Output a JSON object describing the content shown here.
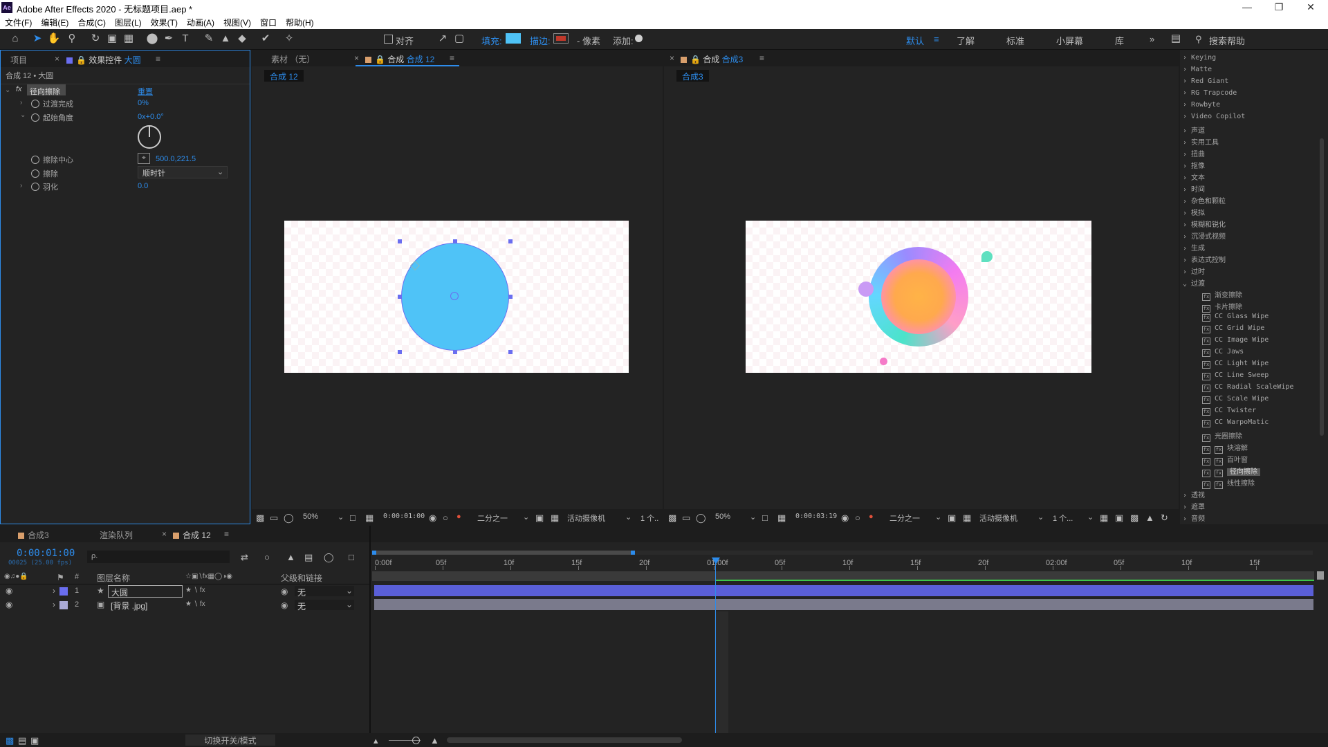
{
  "window": {
    "title": "Adobe After Effects 2020 - 无标题项目.aep *",
    "logo": "Ae"
  },
  "menu": [
    "文件(F)",
    "编辑(E)",
    "合成(C)",
    "图层(L)",
    "效果(T)",
    "动画(A)",
    "视图(V)",
    "窗口",
    "帮助(H)"
  ],
  "toolbar": {
    "align": "对齐",
    "fill": "填充:",
    "stroke": "描边:",
    "pixel": "- 像素",
    "add": "添加:",
    "fill_color": "#4fc3f7",
    "stroke_color": "#c0392b",
    "workspaces": [
      "默认",
      "了解",
      "标准",
      "小屏幕",
      "库"
    ],
    "search_placeholder": "搜索帮助"
  },
  "left_panel": {
    "tab_project": "项目",
    "tab_effects_prefix": "效果控件",
    "tab_effects_layer": "大圆",
    "breadcrumb": "合成 12 • 大圆",
    "effect_name": "径向擦除",
    "reset": "重置",
    "props": [
      {
        "name": "过渡完成",
        "value": "0%"
      },
      {
        "name": "起始角度",
        "value": "0x+0.0°"
      },
      {
        "name": "擦除中心",
        "value": "500.0,221.5"
      },
      {
        "name": "擦除",
        "value": "顺时针"
      },
      {
        "name": "羽化",
        "value": "0.0"
      }
    ]
  },
  "viewer1": {
    "tab_footage": "素材 （无）",
    "tab_comp_prefix": "合成",
    "tab_comp_name": "合成 12",
    "subtab": "合成 12",
    "zoom": "50%",
    "time": "0:00:01:00",
    "res": "二分之一",
    "camera": "活动摄像机",
    "views": "1 个..",
    "circle_color": "#4fc3f7"
  },
  "viewer2": {
    "tab_comp_prefix": "合成",
    "tab_comp_name": "合成3",
    "subtab": "合成3",
    "zoom": "50%",
    "time": "0:00:03:19",
    "res": "二分之一",
    "camera": "活动摄像机",
    "views": "1 个..."
  },
  "effects_list": {
    "categories_top": [
      "Keying",
      "Matte",
      "Red Giant",
      "RG Trapcode",
      "Rowbyte",
      "Video Copilot",
      "声道",
      "实用工具",
      "扭曲",
      "抠像",
      "文本",
      "时间",
      "杂色和颗粒",
      "模拟",
      "模糊和锐化",
      "沉浸式视频",
      "生成",
      "表达式控制",
      "过时",
      "过渡"
    ],
    "transitions": [
      "渐变擦除",
      "卡片擦除",
      "CC Glass Wipe",
      "CC Grid Wipe",
      "CC Image Wipe",
      "CC Jaws",
      "CC Light Wipe",
      "CC Line Sweep",
      "CC Radial ScaleWipe",
      "CC Scale Wipe",
      "CC Twister",
      "CC WarpoMatic",
      "光圈擦除",
      "块溶解",
      "百叶窗",
      "径向擦除",
      "线性擦除"
    ],
    "selected": "径向擦除",
    "categories_bottom": [
      "透视",
      "遮罩",
      "音频"
    ]
  },
  "timeline": {
    "tabs": [
      "合成3",
      "渲染队列",
      "合成 12"
    ],
    "timecode": "0:00:01:00",
    "frames": "00025 (25.00 fps)",
    "search_placeholder": "ρ.",
    "col_layer": "图层名称",
    "col_parent": "父级和链接",
    "col_num": "#",
    "layers": [
      {
        "num": "1",
        "name": "大圆",
        "parent": "无",
        "color": "#6a6ef0"
      },
      {
        "num": "2",
        "name": "[背景 .jpg]",
        "parent": "无",
        "color": "#a9a9d6"
      }
    ],
    "ruler": [
      "0:00f",
      "05f",
      "10f",
      "15f",
      "20f",
      "01:00f",
      "05f",
      "10f",
      "15f",
      "20f",
      "02:00f",
      "05f",
      "10f",
      "15f"
    ],
    "footer_toggle": "切换开关/模式"
  }
}
